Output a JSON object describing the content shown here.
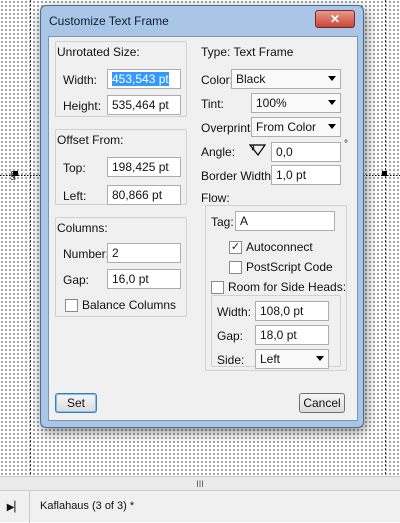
{
  "dialog": {
    "title": "Customize Text Frame",
    "close_label": "✕",
    "unrotated_size": {
      "header": "Unrotated Size:",
      "width_label": "Width:",
      "width_value": "453,543 pt",
      "height_label": "Height:",
      "height_value": "535,464 pt"
    },
    "offset_from": {
      "header": "Offset From:",
      "top_label": "Top:",
      "top_value": "198,425 pt",
      "left_label": "Left:",
      "left_value": "80,866 pt"
    },
    "columns": {
      "header": "Columns:",
      "number_label": "Number:",
      "number_value": "2",
      "gap_label": "Gap:",
      "gap_value": "16,0 pt",
      "balance_label": "Balance Columns",
      "balance_checked": false
    },
    "type_label": "Type:  Text Frame",
    "color_label": "Color:",
    "color_value": "Black",
    "tint_label": "Tint:",
    "tint_value": "100%",
    "overprint_label": "Overprint:",
    "overprint_value": "From Color",
    "angle_label": "Angle:",
    "angle_value": "0,0",
    "angle_unit": "°",
    "border_width_label": "Border Width:",
    "border_width_value": "1,0 pt",
    "flow": {
      "header": "Flow:",
      "tag_label": "Tag:",
      "tag_value": "A",
      "autoconnect_label": "Autoconnect",
      "autoconnect_checked": true,
      "postscript_label": "PostScript Code",
      "postscript_checked": false,
      "side_heads_label": "Room for Side Heads:",
      "side_heads_checked": false,
      "width_label": "Width:",
      "width_value": "108,0 pt",
      "gap_label": "Gap:",
      "gap_value": "18,0 pt",
      "side_label": "Side:",
      "side_value": "Left"
    },
    "set_button": "Set",
    "cancel_button": "Cancel"
  },
  "status": {
    "nav_icon": "play-bar-icon",
    "document_title": "Kaflahaus (3 of 3) *",
    "scroll_grip": "III"
  },
  "colors": {
    "dialog_frame": "#a9c6e6",
    "dialog_body": "#f0f0f0",
    "selection": "#3399ff",
    "close_button": "#c9443a"
  }
}
